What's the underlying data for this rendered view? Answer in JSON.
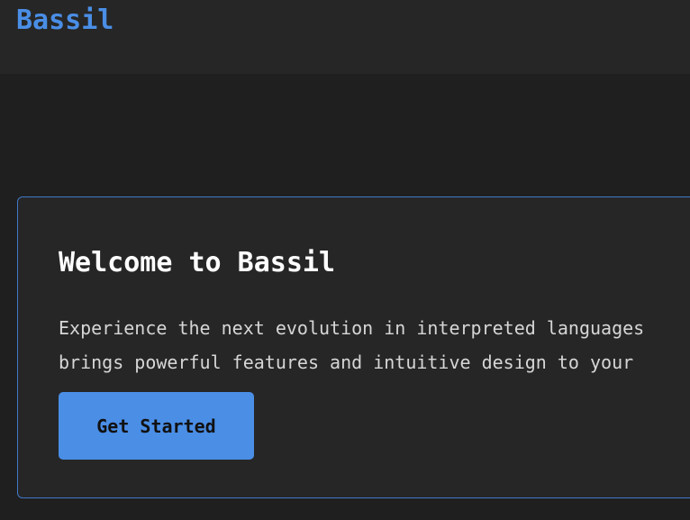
{
  "header": {
    "logo_text": "Bassil"
  },
  "hero": {
    "title": "Welcome to Bassil",
    "description_line1": "Experience the next evolution in interpreted languages",
    "description_line2": "brings powerful features and intuitive design to your",
    "cta_label": "Get Started"
  },
  "colors": {
    "accent": "#4a8ee6",
    "background": "#1f1f1f",
    "header_background": "#262626",
    "card_border": "#3f78c9"
  }
}
